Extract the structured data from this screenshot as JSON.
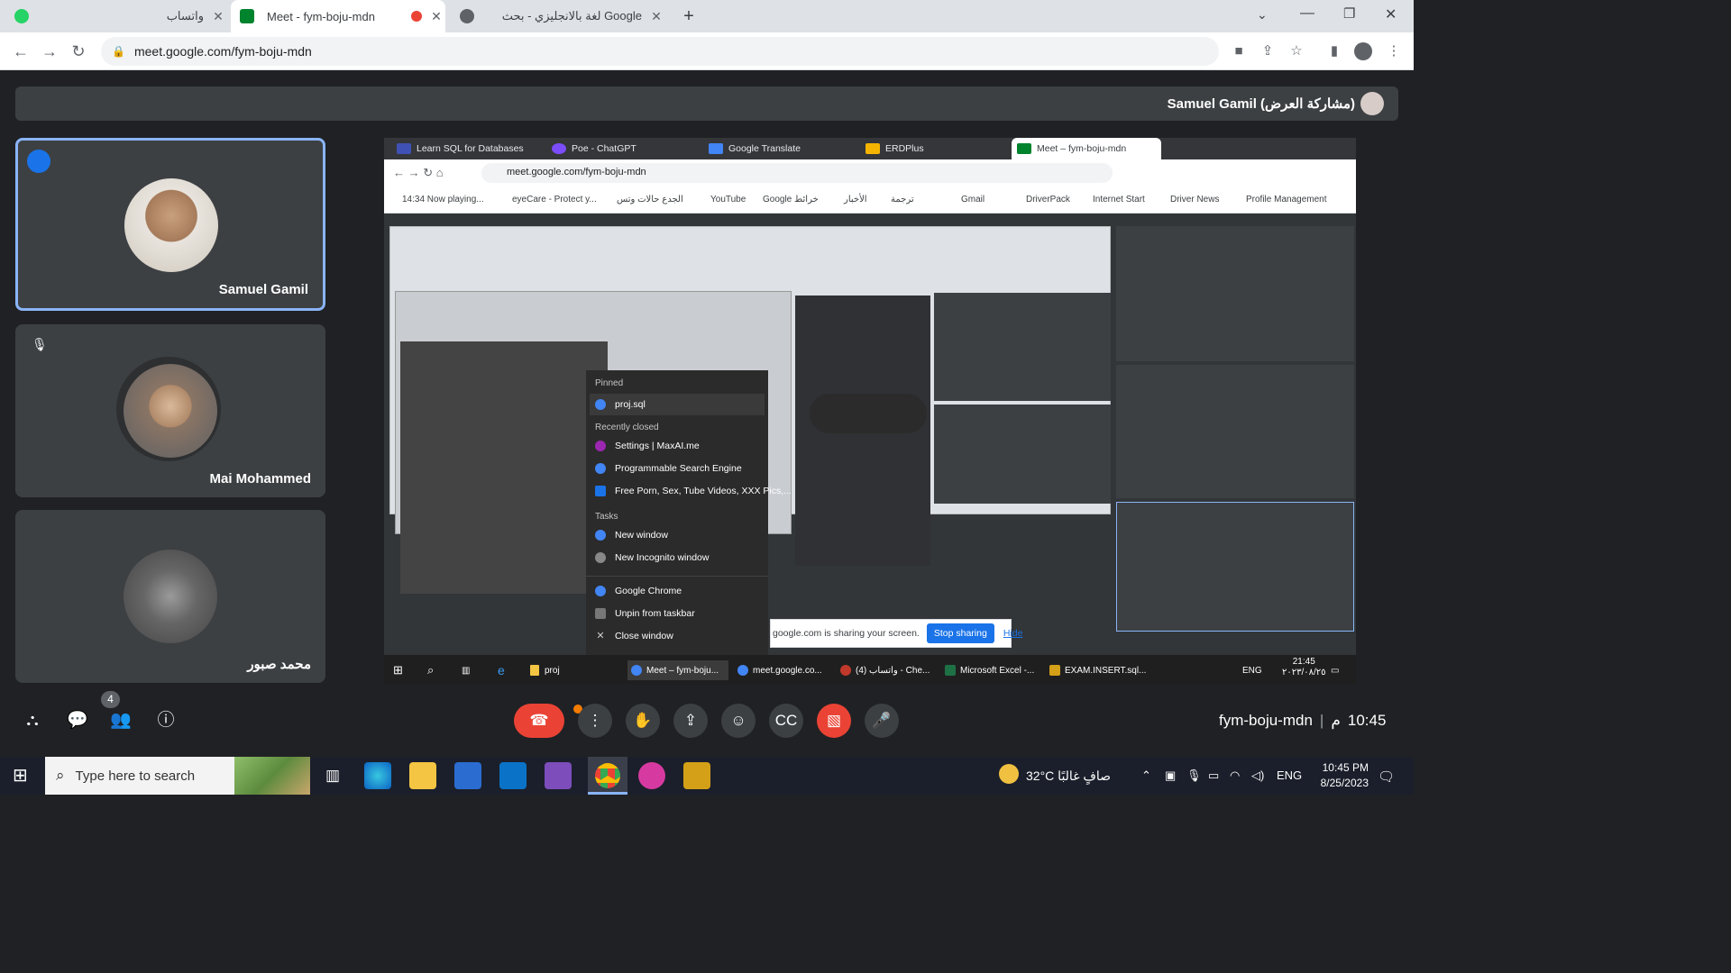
{
  "browser": {
    "tabs": [
      {
        "title": "واتساب",
        "icon": "whatsapp-icon"
      },
      {
        "title": "Meet - fym-boju-mdn",
        "icon": "meet-icon",
        "active": true,
        "recording": true
      },
      {
        "title": "لغة بالانجليزي - بحث Google",
        "icon": "globe-icon"
      }
    ],
    "url": "meet.google.com/fym-boju-mdn"
  },
  "meet": {
    "presenter_label": "Samuel Gamil (مشاركة العرض)",
    "participants": [
      {
        "name": "Samuel Gamil",
        "speaking": true
      },
      {
        "name": "Mai Mohammed",
        "muted": true
      },
      {
        "name": "محمد صبور"
      }
    ],
    "people_count": "4",
    "time": "10:45",
    "time_suffix": "م",
    "meeting_code": "fym-boju-mdn"
  },
  "shared_screen": {
    "tabs": [
      "Learn SQL for Databases",
      "Poe - ChatGPT",
      "Google Translate",
      "ERDPlus",
      "Meet – fym-boju-mdn"
    ],
    "url": "meet.google.com/fym-boju-mdn",
    "bookmarks": [
      "14:34 Now playing...",
      "eyeCare - Protect y...",
      "الجدع حالات وتس",
      "YouTube",
      "Google خرائط",
      "الأخبار",
      "ترجمة",
      "Gmail",
      "DriverPack",
      "Internet Start",
      "Driver News",
      "Profile Management"
    ],
    "jumplist": {
      "pinned_header": "Pinned",
      "pinned": [
        "proj.sql"
      ],
      "recent_header": "Recently closed",
      "recent": [
        "Settings | MaxAI.me",
        "Programmable Search Engine",
        "Free Porn, Sex, Tube Videos, XXX Pics,..."
      ],
      "tasks_header": "Tasks",
      "tasks": [
        "New window",
        "New Incognito window"
      ],
      "actions": [
        "Google Chrome",
        "Unpin from taskbar",
        "Close window"
      ]
    },
    "sharing_bar": {
      "text": "google.com is sharing your screen.",
      "stop": "Stop sharing",
      "hide": "Hide"
    },
    "taskbar_items": [
      "proj",
      "Meet – fym-boju...",
      "meet.google.co...",
      "(4) واتساب - Che...",
      "Microsoft Excel -...",
      "EXAM.INSERT.sql..."
    ],
    "tray_lang": "ENG",
    "tray_time": "21:45",
    "tray_date": "٢٠٢٣/٠٨/٢٥"
  },
  "windows": {
    "search_placeholder": "Type here to search",
    "weather": "32°C صافٍ غالبًا",
    "lang": "ENG",
    "time": "10:45 PM",
    "date": "8/25/2023"
  },
  "colors": {
    "accent": "#8ab4f8",
    "danger": "#ea4335",
    "speaking": "#1a73e8"
  }
}
